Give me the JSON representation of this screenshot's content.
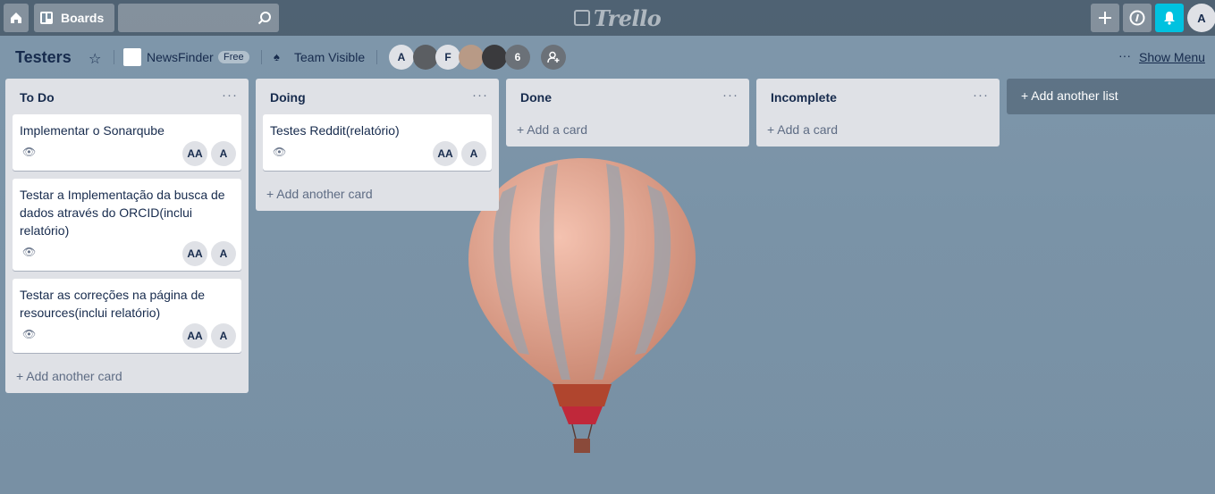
{
  "topbar": {
    "boards_label": "Boards",
    "logo_text": "Trello",
    "avatar_initial": "A",
    "notify_color": "#00c2e0"
  },
  "board": {
    "title": "Testers",
    "team_name": "NewsFinder",
    "team_badge": "Free",
    "visibility": "Team Visible",
    "members": [
      {
        "initials": "A"
      },
      {
        "initials": ""
      },
      {
        "initials": "F"
      },
      {
        "initials": ""
      },
      {
        "initials": ""
      }
    ],
    "more_members": "6",
    "show_menu": "Show Menu"
  },
  "lists": [
    {
      "title": "To Do",
      "cards": [
        {
          "title": "Implementar o Sonarqube",
          "avatars": [
            "AA",
            "A"
          ]
        },
        {
          "title": "Testar a Implementação da busca de dados através do ORCID(inclui relatório)",
          "avatars": [
            "AA",
            "A"
          ]
        },
        {
          "title": "Testar as correções na página de resources(inclui relatório)",
          "avatars": [
            "AA",
            "A"
          ]
        }
      ],
      "add_label": "Add another card"
    },
    {
      "title": "Doing",
      "cards": [
        {
          "title": "Testes Reddit(relatório)",
          "avatars": [
            "AA",
            "A"
          ]
        }
      ],
      "add_label": "Add another card"
    },
    {
      "title": "Done",
      "cards": [],
      "add_label": "Add a card"
    },
    {
      "title": "Incomplete",
      "cards": [],
      "add_label": "Add a card"
    }
  ],
  "add_list_label": "Add another list"
}
